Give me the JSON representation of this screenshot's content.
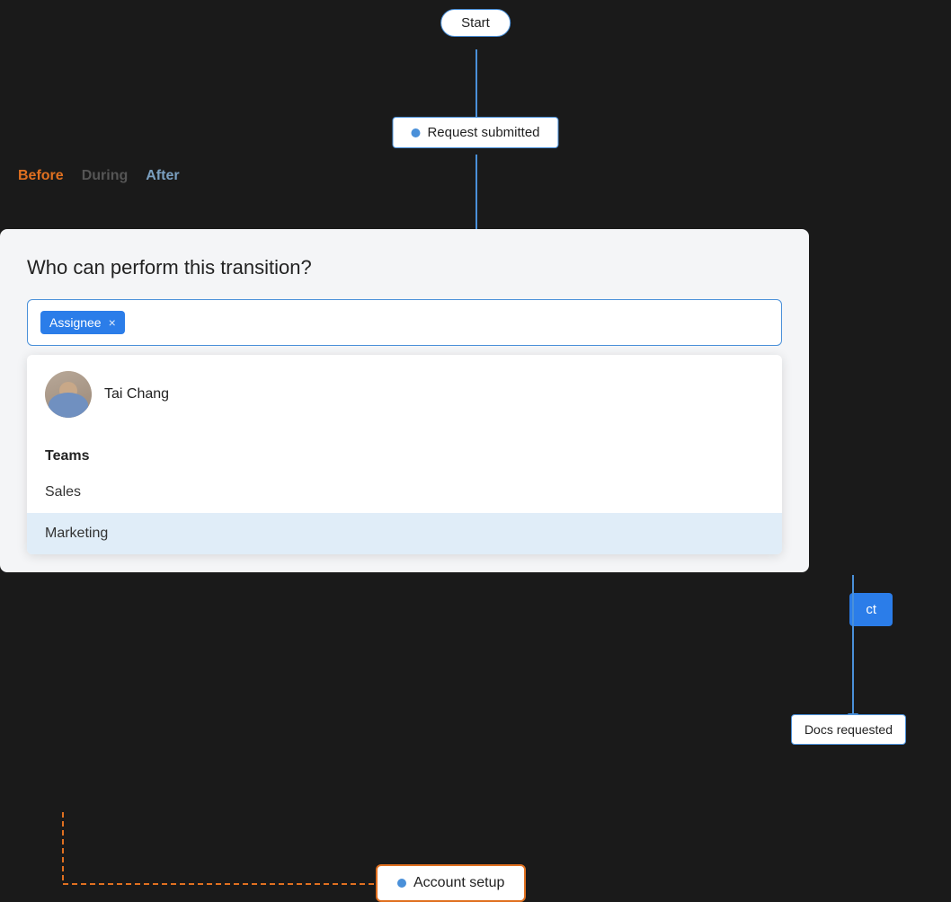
{
  "nodes": {
    "start": "Start",
    "request_submitted": "Request submitted",
    "docs_requested": "Docs requested",
    "account_setup": "Account setup"
  },
  "tabs": {
    "before": "Before",
    "during": "During",
    "after": "After"
  },
  "panel": {
    "question": "Who can perform this transition?",
    "tag_label": "Assignee",
    "tag_close": "×",
    "person_name": "Tai Chang",
    "section_teams": "Teams",
    "team_sales": "Sales",
    "team_marketing": "Marketing"
  },
  "button": {
    "select": "ct"
  }
}
